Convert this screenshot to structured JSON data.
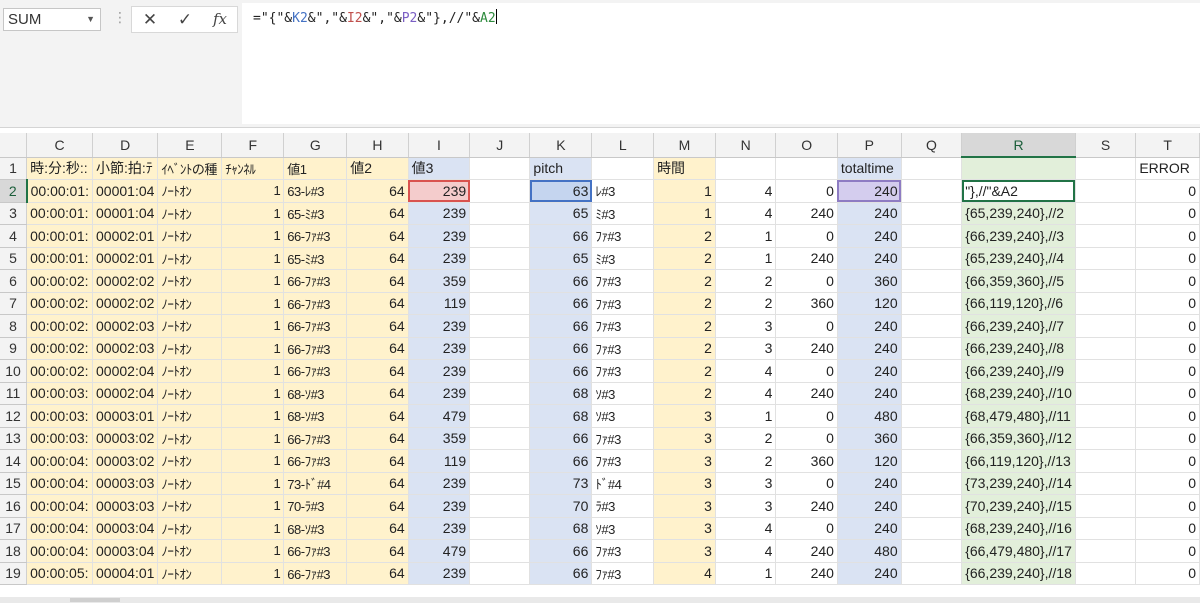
{
  "formula_bar": {
    "name_box": "SUM",
    "cancel_icon": "✕",
    "enter_icon": "✓",
    "fx_label": "fx",
    "formula_parts": [
      "=\"{\"&",
      "K2",
      "&\",\"&",
      "I2",
      "&\",\"&",
      "P2",
      "&\"},//\"&",
      "A2"
    ]
  },
  "columns": [
    "C",
    "D",
    "E",
    "F",
    "G",
    "H",
    "I",
    "J",
    "K",
    "L",
    "M",
    "N",
    "O",
    "P",
    "Q",
    "R",
    "S",
    "T"
  ],
  "selected_column": "R",
  "selected_row": "2",
  "header_row": {
    "row": "1",
    "cells": [
      "時:分:秒::",
      "小節:拍:ﾃ",
      "ｲﾍﾞﾝﾄの種",
      "ﾁｬﾝﾈﾙ",
      "値1",
      "値2",
      "値3",
      "",
      "pitch",
      "",
      "時間",
      "",
      "",
      "totaltime",
      "",
      "",
      "",
      "ERROR"
    ]
  },
  "rows": [
    {
      "row": "2",
      "c": [
        "00:00:01:",
        "00001:04",
        "ﾉｰﾄｵﾝ",
        "1",
        "63-ﾚ#3",
        "64",
        "239",
        "",
        "63",
        "ﾚ#3",
        "1",
        "4",
        "0",
        "240",
        "",
        "\"},//\"&A2",
        "",
        "0"
      ]
    },
    {
      "row": "3",
      "c": [
        "00:00:01:",
        "00001:04",
        "ﾉｰﾄｵﾝ",
        "1",
        "65-ﾐ#3",
        "64",
        "239",
        "",
        "65",
        "ﾐ#3",
        "1",
        "4",
        "240",
        "240",
        "",
        "{65,239,240},//2",
        "",
        "0"
      ]
    },
    {
      "row": "4",
      "c": [
        "00:00:01:",
        "00002:01",
        "ﾉｰﾄｵﾝ",
        "1",
        "66-ﾌｧ#3",
        "64",
        "239",
        "",
        "66",
        "ﾌｧ#3",
        "2",
        "1",
        "0",
        "240",
        "",
        "{66,239,240},//3",
        "",
        "0"
      ]
    },
    {
      "row": "5",
      "c": [
        "00:00:01:",
        "00002:01",
        "ﾉｰﾄｵﾝ",
        "1",
        "65-ﾐ#3",
        "64",
        "239",
        "",
        "65",
        "ﾐ#3",
        "2",
        "1",
        "240",
        "240",
        "",
        "{65,239,240},//4",
        "",
        "0"
      ]
    },
    {
      "row": "6",
      "c": [
        "00:00:02:",
        "00002:02",
        "ﾉｰﾄｵﾝ",
        "1",
        "66-ﾌｧ#3",
        "64",
        "359",
        "",
        "66",
        "ﾌｧ#3",
        "2",
        "2",
        "0",
        "360",
        "",
        "{66,359,360},//5",
        "",
        "0"
      ]
    },
    {
      "row": "7",
      "c": [
        "00:00:02:",
        "00002:02",
        "ﾉｰﾄｵﾝ",
        "1",
        "66-ﾌｧ#3",
        "64",
        "119",
        "",
        "66",
        "ﾌｧ#3",
        "2",
        "2",
        "360",
        "120",
        "",
        "{66,119,120},//6",
        "",
        "0"
      ]
    },
    {
      "row": "8",
      "c": [
        "00:00:02:",
        "00002:03",
        "ﾉｰﾄｵﾝ",
        "1",
        "66-ﾌｧ#3",
        "64",
        "239",
        "",
        "66",
        "ﾌｧ#3",
        "2",
        "3",
        "0",
        "240",
        "",
        "{66,239,240},//7",
        "",
        "0"
      ]
    },
    {
      "row": "9",
      "c": [
        "00:00:02:",
        "00002:03",
        "ﾉｰﾄｵﾝ",
        "1",
        "66-ﾌｧ#3",
        "64",
        "239",
        "",
        "66",
        "ﾌｧ#3",
        "2",
        "3",
        "240",
        "240",
        "",
        "{66,239,240},//8",
        "",
        "0"
      ]
    },
    {
      "row": "10",
      "c": [
        "00:00:02:",
        "00002:04",
        "ﾉｰﾄｵﾝ",
        "1",
        "66-ﾌｧ#3",
        "64",
        "239",
        "",
        "66",
        "ﾌｧ#3",
        "2",
        "4",
        "0",
        "240",
        "",
        "{66,239,240},//9",
        "",
        "0"
      ]
    },
    {
      "row": "11",
      "c": [
        "00:00:03:",
        "00002:04",
        "ﾉｰﾄｵﾝ",
        "1",
        "68-ｿ#3",
        "64",
        "239",
        "",
        "68",
        "ｿ#3",
        "2",
        "4",
        "240",
        "240",
        "",
        "{68,239,240},//10",
        "",
        "0"
      ]
    },
    {
      "row": "12",
      "c": [
        "00:00:03:",
        "00003:01",
        "ﾉｰﾄｵﾝ",
        "1",
        "68-ｿ#3",
        "64",
        "479",
        "",
        "68",
        "ｿ#3",
        "3",
        "1",
        "0",
        "480",
        "",
        "{68,479,480},//11",
        "",
        "0"
      ]
    },
    {
      "row": "13",
      "c": [
        "00:00:03:",
        "00003:02",
        "ﾉｰﾄｵﾝ",
        "1",
        "66-ﾌｧ#3",
        "64",
        "359",
        "",
        "66",
        "ﾌｧ#3",
        "3",
        "2",
        "0",
        "360",
        "",
        "{66,359,360},//12",
        "",
        "0"
      ]
    },
    {
      "row": "14",
      "c": [
        "00:00:04:",
        "00003:02",
        "ﾉｰﾄｵﾝ",
        "1",
        "66-ﾌｧ#3",
        "64",
        "119",
        "",
        "66",
        "ﾌｧ#3",
        "3",
        "2",
        "360",
        "120",
        "",
        "{66,119,120},//13",
        "",
        "0"
      ]
    },
    {
      "row": "15",
      "c": [
        "00:00:04:",
        "00003:03",
        "ﾉｰﾄｵﾝ",
        "1",
        "73-ﾄﾞ#4",
        "64",
        "239",
        "",
        "73",
        "ﾄﾞ#4",
        "3",
        "3",
        "0",
        "240",
        "",
        "{73,239,240},//14",
        "",
        "0"
      ]
    },
    {
      "row": "16",
      "c": [
        "00:00:04:",
        "00003:03",
        "ﾉｰﾄｵﾝ",
        "1",
        "70-ﾗ#3",
        "64",
        "239",
        "",
        "70",
        "ﾗ#3",
        "3",
        "3",
        "240",
        "240",
        "",
        "{70,239,240},//15",
        "",
        "0"
      ]
    },
    {
      "row": "17",
      "c": [
        "00:00:04:",
        "00003:04",
        "ﾉｰﾄｵﾝ",
        "1",
        "68-ｿ#3",
        "64",
        "239",
        "",
        "68",
        "ｿ#3",
        "3",
        "4",
        "0",
        "240",
        "",
        "{68,239,240},//16",
        "",
        "0"
      ]
    },
    {
      "row": "18",
      "c": [
        "00:00:04:",
        "00003:04",
        "ﾉｰﾄｵﾝ",
        "1",
        "66-ﾌｧ#3",
        "64",
        "479",
        "",
        "66",
        "ﾌｧ#3",
        "3",
        "4",
        "240",
        "480",
        "",
        "{66,479,480},//17",
        "",
        "0"
      ]
    },
    {
      "row": "19",
      "c": [
        "00:00:05:",
        "00004:01",
        "ﾉｰﾄｵﾝ",
        "1",
        "66-ﾌｧ#3",
        "64",
        "239",
        "",
        "66",
        "ﾌｧ#3",
        "4",
        "1",
        "240",
        "240",
        "",
        "{66,239,240},//18",
        "",
        "0"
      ]
    }
  ],
  "colors": {
    "yellow_fill": "#fff2cc",
    "blue_fill": "#dae3f3",
    "green_fill": "#e2efda",
    "selection": "#217346"
  }
}
